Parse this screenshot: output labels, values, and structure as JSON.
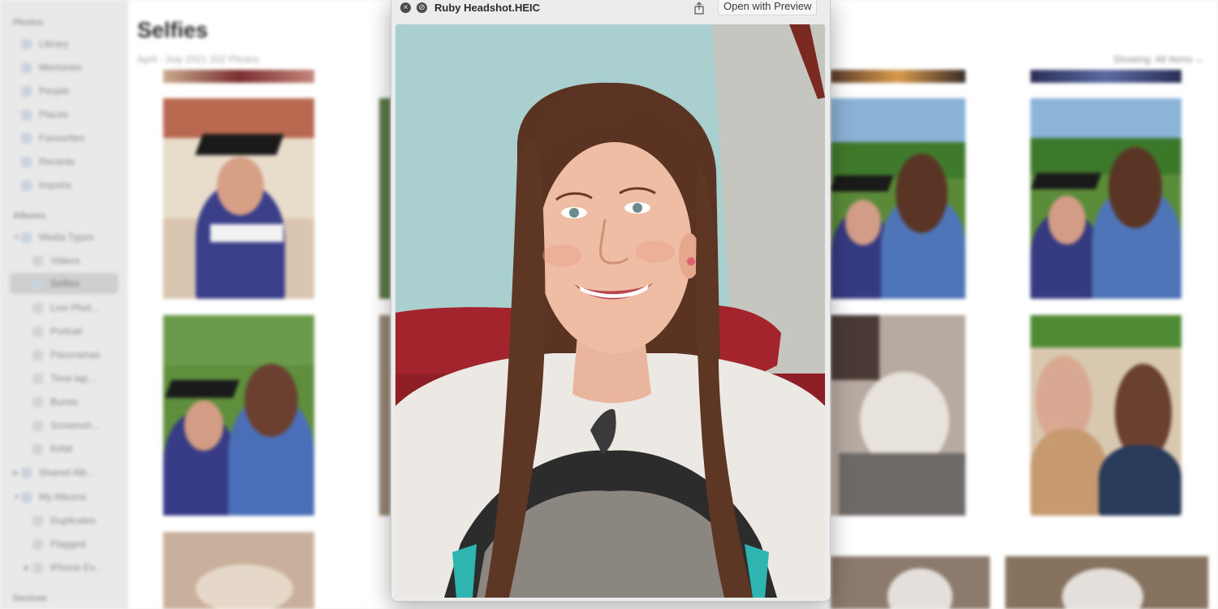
{
  "sidebar": {
    "section_photos": "Photos",
    "items": [
      {
        "label": "Library"
      },
      {
        "label": "Memories"
      },
      {
        "label": "People"
      },
      {
        "label": "Places"
      },
      {
        "label": "Favourites"
      },
      {
        "label": "Recents"
      },
      {
        "label": "Imports"
      }
    ],
    "section_albums": "Albums",
    "album_items": [
      {
        "label": "Media Types"
      },
      {
        "label": "Videos"
      },
      {
        "label": "Selfies"
      },
      {
        "label": "Live Phot..."
      },
      {
        "label": "Portrait"
      },
      {
        "label": "Panoramas"
      },
      {
        "label": "Time-lap..."
      },
      {
        "label": "Bursts"
      },
      {
        "label": "Screensh..."
      },
      {
        "label": "RAW"
      },
      {
        "label": "Shared Alb..."
      },
      {
        "label": "My Albums"
      },
      {
        "label": "Duplicates"
      },
      {
        "label": "Flagged"
      },
      {
        "label": "iPhone Ev..."
      }
    ],
    "section_devices": "Devices"
  },
  "main": {
    "title": "Selfies",
    "subtitle": "April - July 2021    332 Photos",
    "showing": "Showing: All Items ⌄"
  },
  "quicklook": {
    "close_icon": "×",
    "fullscreen_icon": "⊘",
    "title": "Ruby Headshot.HEIC",
    "open_with_label": "Open with Preview"
  },
  "colors": {
    "accent_red": "#a3242c",
    "wall": "#a9cfcf"
  }
}
